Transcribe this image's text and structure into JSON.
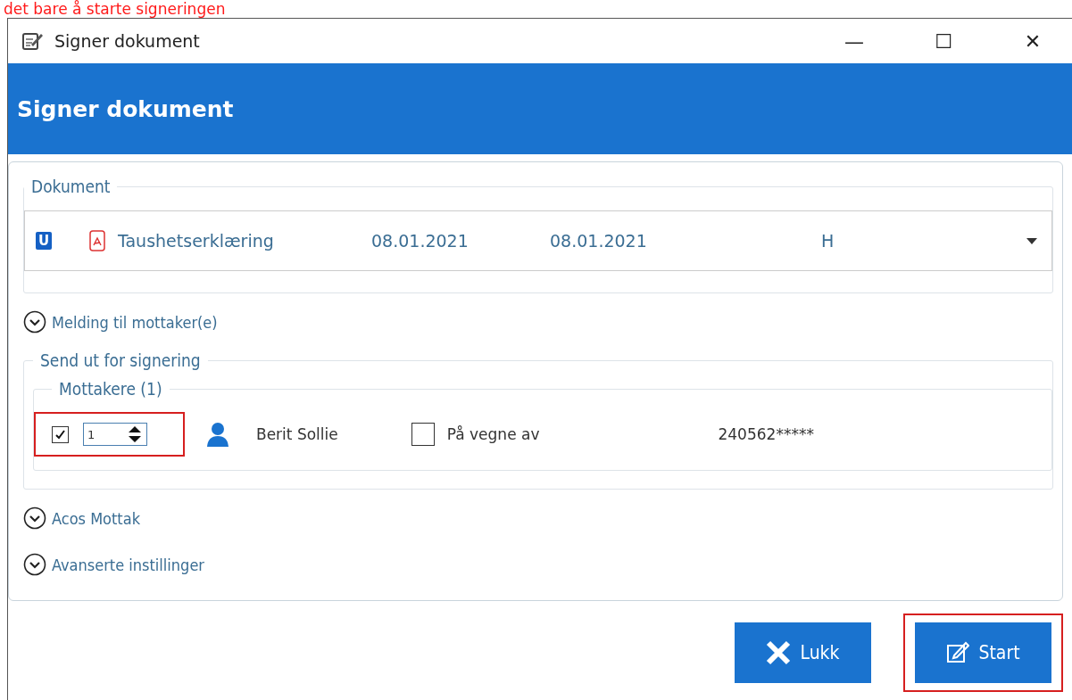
{
  "caption": "det bare å starte signeringen",
  "window": {
    "title": "Signer dokument",
    "controls": [
      "—",
      "☐",
      "✕"
    ]
  },
  "header": {
    "title": "Signer dokument"
  },
  "document_group": {
    "legend": "Dokument",
    "document": {
      "badge": "U",
      "name": "Taushetserklæring",
      "date_1": "08.01.2021",
      "date_2": "08.01.2021",
      "column_5": "H"
    }
  },
  "message_toggle": {
    "label": "Melding til mottaker(e)",
    "expanded": false
  },
  "send_group": {
    "legend": "Send ut for signering",
    "recipients": {
      "legend": "Mottakere (1)",
      "rows": [
        {
          "checked": true,
          "order": "1",
          "highlighted": true,
          "name": "Berit Sollie",
          "on_behalf": {
            "label": "På vegne av",
            "checked": false
          },
          "id_number": "240562*****"
        }
      ]
    }
  },
  "sections": [
    {
      "label": "Acos Mottak",
      "expanded": false
    },
    {
      "label": "Avanserte instillinger",
      "expanded": false
    }
  ],
  "buttons": [
    {
      "kind": "close",
      "label": "Lukk",
      "highlighted": false
    },
    {
      "kind": "start",
      "label": "Start",
      "highlighted": true
    }
  ]
}
